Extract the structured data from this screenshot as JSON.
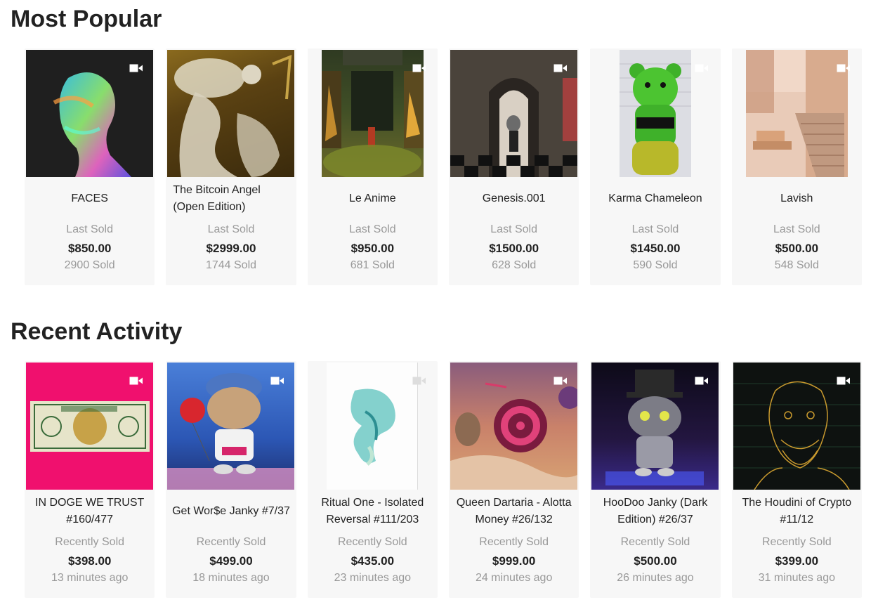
{
  "sections": {
    "popular": {
      "title": "Most Popular",
      "status_label": "Last Sold",
      "items": [
        {
          "name": "FACES",
          "price": "$850.00",
          "meta": "2900 Sold"
        },
        {
          "name": "The Bitcoin Angel (Open Edition)",
          "price": "$2999.00",
          "meta": "1744 Sold"
        },
        {
          "name": "Le Anime",
          "price": "$950.00",
          "meta": "681 Sold"
        },
        {
          "name": "Genesis.001",
          "price": "$1500.00",
          "meta": "628 Sold"
        },
        {
          "name": "Karma Chameleon",
          "price": "$1450.00",
          "meta": "590 Sold"
        },
        {
          "name": "Lavish",
          "price": "$500.00",
          "meta": "548 Sold"
        }
      ]
    },
    "recent": {
      "title": "Recent Activity",
      "status_label": "Recently Sold",
      "items": [
        {
          "name": "IN DOGE WE TRUST #160/477",
          "price": "$398.00",
          "meta": "13 minutes ago"
        },
        {
          "name": "Get Wor$e Janky #7/37",
          "price": "$499.00",
          "meta": "18 minutes ago"
        },
        {
          "name": "Ritual One - Isolated Reversal #111/203",
          "price": "$435.00",
          "meta": "23 minutes ago"
        },
        {
          "name": "Queen Dartaria - Alotta Money #26/132",
          "price": "$999.00",
          "meta": "24 minutes ago"
        },
        {
          "name": "HooDoo Janky (Dark Edition) #26/37",
          "price": "$500.00",
          "meta": "26 minutes ago"
        },
        {
          "name": "The Houdini of Crypto #11/12",
          "price": "$399.00",
          "meta": "31 minutes ago"
        }
      ]
    }
  },
  "icons": {
    "video": "video-camera-icon"
  },
  "colors": {
    "muted_text": "#999999",
    "card_bg": "#f7f7f7",
    "heading": "#222222"
  }
}
